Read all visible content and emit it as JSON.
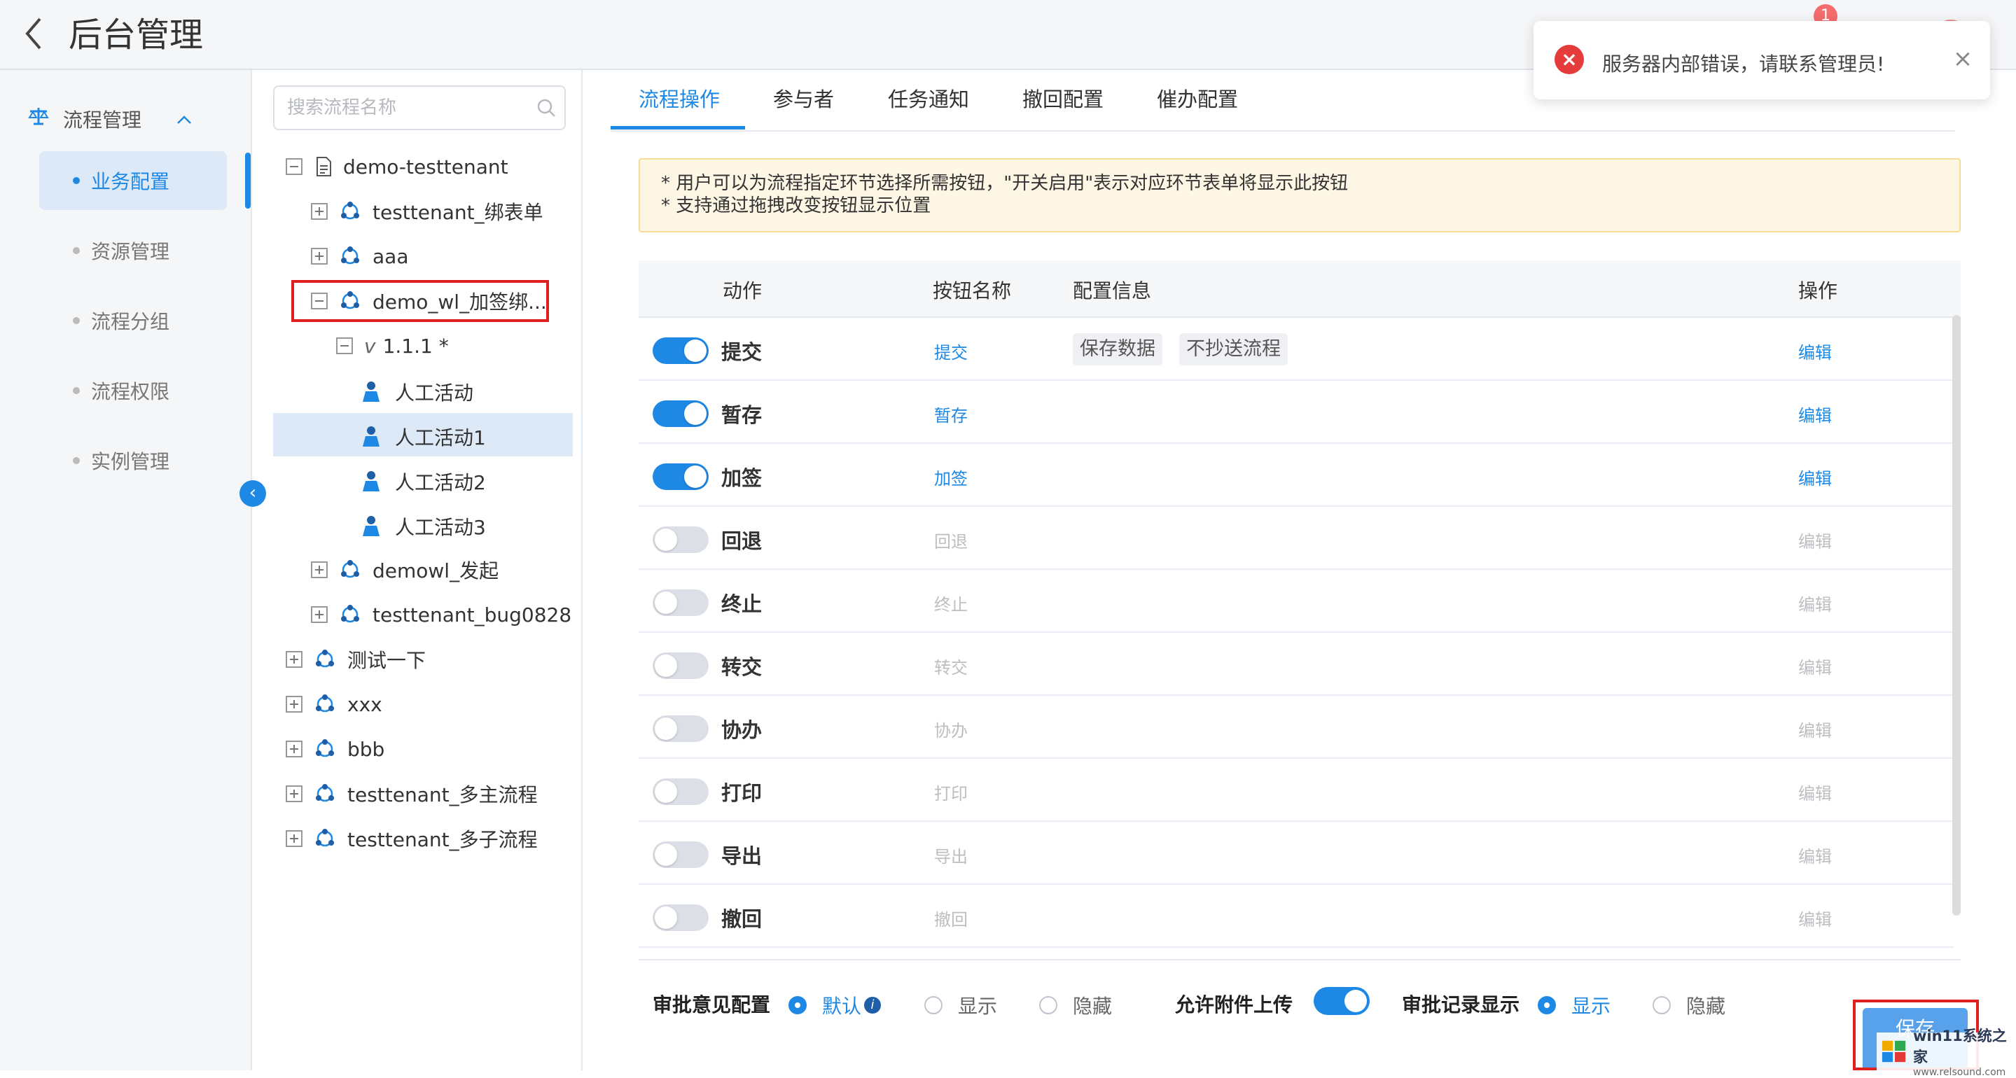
{
  "header": {
    "title": "后台管理",
    "notification_count": "1"
  },
  "toast": {
    "message": "服务器内部错误，请联系管理员!"
  },
  "nav": {
    "group_label": "流程管理",
    "items": [
      {
        "label": "业务配置",
        "active": true
      },
      {
        "label": "资源管理",
        "active": false
      },
      {
        "label": "流程分组",
        "active": false
      },
      {
        "label": "流程权限",
        "active": false
      },
      {
        "label": "实例管理",
        "active": false
      }
    ]
  },
  "tree": {
    "search_placeholder": "搜索流程名称",
    "nodes": [
      {
        "label": "demo-testtenant",
        "level": 0,
        "toggle": "minus",
        "icon": "doc-icon"
      },
      {
        "label": "testtenant_绑表单",
        "level": 1,
        "toggle": "plus",
        "icon": "flow-icon"
      },
      {
        "label": "aaa",
        "level": 1,
        "toggle": "plus",
        "icon": "flow-icon"
      },
      {
        "label": "demo_wl_加签绑...",
        "level": 1,
        "toggle": "minus",
        "icon": "flow-icon"
      },
      {
        "label": "1.1.1 *",
        "version_prefix": "v",
        "level": 2,
        "toggle": "minus"
      },
      {
        "label": "人工活动",
        "level": 3,
        "icon": "person-icon"
      },
      {
        "label": "人工活动1",
        "level": 3,
        "icon": "person-icon",
        "selected": true
      },
      {
        "label": "人工活动2",
        "level": 3,
        "icon": "person-icon"
      },
      {
        "label": "人工活动3",
        "level": 3,
        "icon": "person-icon"
      },
      {
        "label": "demowl_发起",
        "level": 1,
        "toggle": "plus",
        "icon": "flow-icon"
      },
      {
        "label": "testtenant_bug0828",
        "level": 1,
        "toggle": "plus",
        "icon": "flow-icon"
      },
      {
        "label": "测试一下",
        "level": 0,
        "toggle": "plus",
        "icon": "flow-icon"
      },
      {
        "label": "xxx",
        "level": 0,
        "toggle": "plus",
        "icon": "flow-icon"
      },
      {
        "label": "bbb",
        "level": 0,
        "toggle": "plus",
        "icon": "flow-icon"
      },
      {
        "label": "testtenant_多主流程",
        "level": 0,
        "toggle": "plus",
        "icon": "flow-icon"
      },
      {
        "label": "testtenant_多子流程",
        "level": 0,
        "toggle": "plus",
        "icon": "flow-icon"
      }
    ]
  },
  "tabs": [
    "流程操作",
    "参与者",
    "任务通知",
    "撤回配置",
    "催办配置"
  ],
  "notice": {
    "line1": "* 用户可以为流程指定环节选择所需按钮，\"开关启用\"表示对应环节表单将显示此按钮",
    "line2": "* 支持通过拖拽改变按钮显示位置"
  },
  "table": {
    "headers": {
      "action": "动作",
      "button_name": "按钮名称",
      "config": "配置信息",
      "operation": "操作"
    },
    "rows": [
      {
        "action": "提交",
        "button": "提交",
        "enabled": true,
        "tags": [
          "保存数据",
          "不抄送流程"
        ],
        "edit": "编辑"
      },
      {
        "action": "暂存",
        "button": "暂存",
        "enabled": true,
        "tags": [],
        "edit": "编辑"
      },
      {
        "action": "加签",
        "button": "加签",
        "enabled": true,
        "tags": [],
        "edit": "编辑"
      },
      {
        "action": "回退",
        "button": "回退",
        "enabled": false,
        "tags": [],
        "edit": "编辑"
      },
      {
        "action": "终止",
        "button": "终止",
        "enabled": false,
        "tags": [],
        "edit": "编辑"
      },
      {
        "action": "转交",
        "button": "转交",
        "enabled": false,
        "tags": [],
        "edit": "编辑"
      },
      {
        "action": "协办",
        "button": "协办",
        "enabled": false,
        "tags": [],
        "edit": "编辑"
      },
      {
        "action": "打印",
        "button": "打印",
        "enabled": false,
        "tags": [],
        "edit": "编辑"
      },
      {
        "action": "导出",
        "button": "导出",
        "enabled": false,
        "tags": [],
        "edit": "编辑"
      },
      {
        "action": "撤回",
        "button": "撤回",
        "enabled": false,
        "tags": [],
        "edit": "编辑"
      }
    ]
  },
  "bottom": {
    "opinion_label": "审批意见配置",
    "opinion_options": [
      "默认",
      "显示",
      "隐藏"
    ],
    "opinion_selected": "默认",
    "attach_label": "允许附件上传",
    "attach_enabled": true,
    "record_label": "审批记录显示",
    "record_options": [
      "显示",
      "隐藏"
    ],
    "record_selected": "显示"
  },
  "save_label": "保存",
  "watermark": {
    "line1": "win11系统之家",
    "line2": "www.relsound.com"
  }
}
